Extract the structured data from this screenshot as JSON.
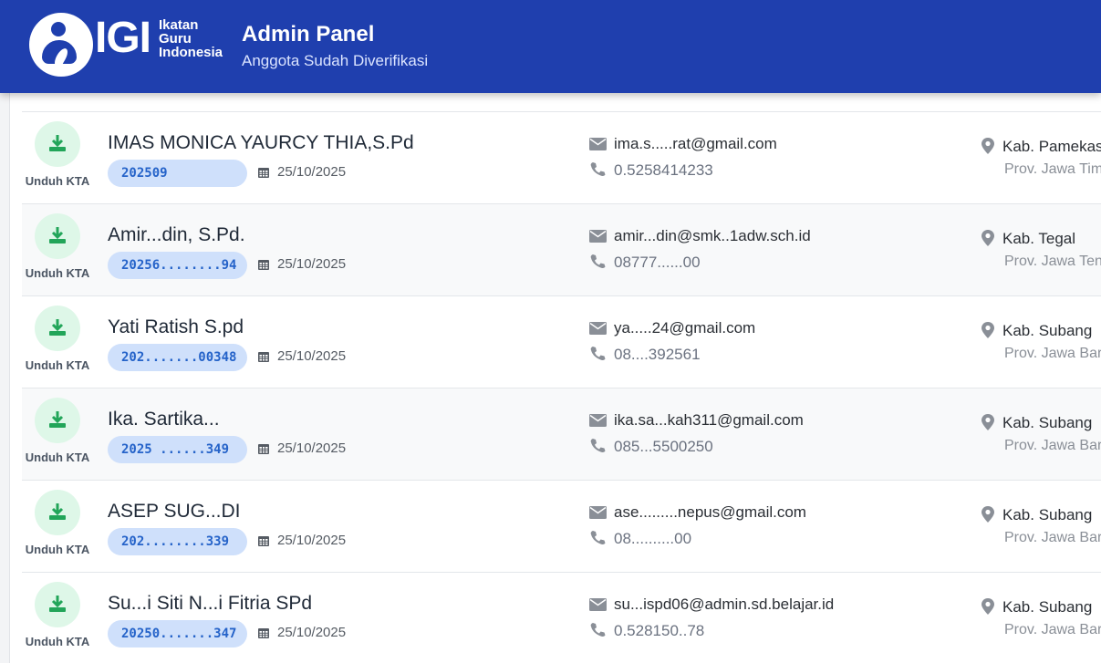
{
  "header": {
    "logo_main": "IGI",
    "logo_line1": "Ikatan",
    "logo_line2": "Guru",
    "logo_line3": "Indonesia",
    "title": "Admin Panel",
    "subtitle": "Anggota Sudah Diverifikasi"
  },
  "colors": {
    "header": "#1f3fae",
    "badge_bg": "#cfe0fb",
    "download_bg": "#def7e8",
    "download_icon": "#22a559"
  },
  "members": [
    {
      "download_label": "Unduh KTA",
      "name": "IMAS MONICA YAURCY THIA,S.Pd",
      "id": "202509",
      "date": "25/10/2025",
      "email": "ima.s.....rat@gmail.com",
      "phone": "0.5258414233",
      "kab": "Kab. Pamekasan",
      "prov": "Prov. Jawa Timur"
    },
    {
      "download_label": "Unduh KTA",
      "name": "Amir...din, S.Pd.",
      "id": "20256........94",
      "date": "25/10/2025",
      "email": "amir...din@smk..1adw.sch.id",
      "phone": "08777......00",
      "kab": "Kab. Tegal",
      "prov": "Prov. Jawa Tengah"
    },
    {
      "download_label": "Unduh KTA",
      "name": "Yati Ratish S.pd",
      "id": "202.......00348",
      "date": "25/10/2025",
      "email": "ya.....24@gmail.com",
      "phone": "08....392561",
      "kab": "Kab. Subang",
      "prov": "Prov. Jawa Barat"
    },
    {
      "download_label": "Unduh KTA",
      "name": "Ika. Sartika...",
      "id": "2025 ......349",
      "date": "25/10/2025",
      "email": "ika.sa...kah311@gmail.com",
      "phone": "085...5500250",
      "kab": "Kab. Subang",
      "prov": "Prov. Jawa Barat"
    },
    {
      "download_label": "Unduh KTA",
      "name": "ASEP SUG...DI",
      "id": "202........339",
      "date": "25/10/2025",
      "email": "ase.........nepus@gmail.com",
      "phone": "08..........00",
      "kab": "Kab. Subang",
      "prov": "Prov. Jawa Barat"
    },
    {
      "download_label": "Unduh KTA",
      "name": "Su...i Siti N...i Fitria SPd",
      "id": "20250.......347",
      "date": "25/10/2025",
      "email": "su...ispd06@admin.sd.belajar.id",
      "phone": "0.528150..78",
      "kab": "Kab. Subang",
      "prov": "Prov. Jawa Barat"
    }
  ]
}
